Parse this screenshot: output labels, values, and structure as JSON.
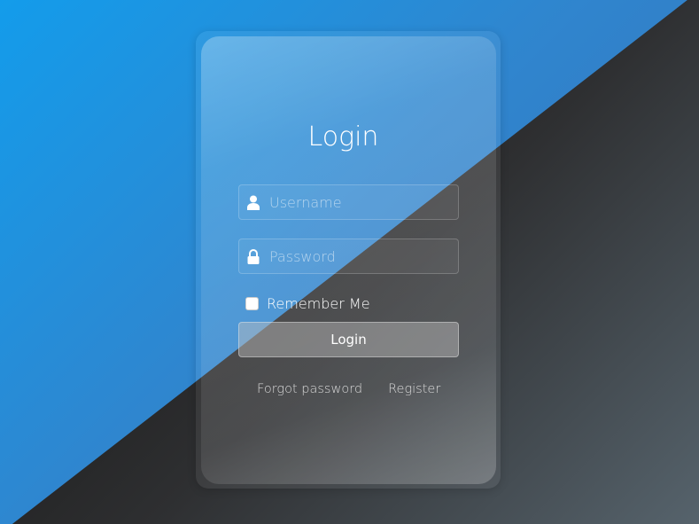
{
  "title": "Login",
  "username": {
    "placeholder": "Username",
    "icon": "user-icon"
  },
  "password": {
    "placeholder": "Password",
    "icon": "lock-icon"
  },
  "remember_label": "Remember Me",
  "remember_checked": false,
  "login_button": "Login",
  "links": {
    "forgot": "Forgot password",
    "register": "Register"
  }
}
